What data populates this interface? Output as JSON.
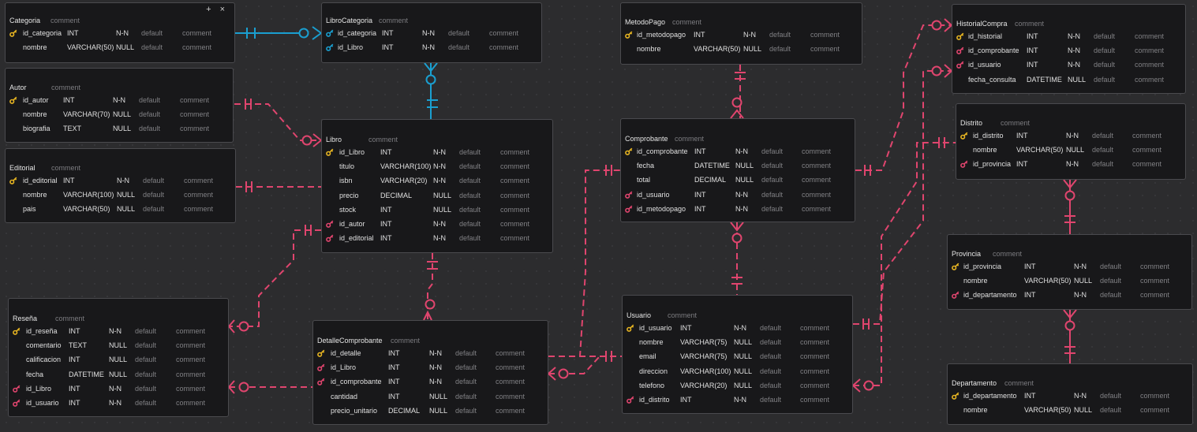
{
  "colors": {
    "pk": "#e6b422",
    "fk_red": "#e0456e",
    "fk_blue": "#1a9fd0",
    "link_red": "#e0456e",
    "link_blue": "#1a9fd0"
  },
  "icons": {
    "pk": "key-icon",
    "fk": "foreign-key-icon",
    "add": "plus-icon",
    "close": "close-icon"
  },
  "tables": [
    {
      "id": "categoria",
      "name": "Categoria",
      "comment": "comment",
      "controls": "+ ×",
      "fields": [
        {
          "name": "id_categoria",
          "type": "INT",
          "null": "N-N",
          "default": "default",
          "comment": "comment",
          "key": "pk"
        },
        {
          "name": "nombre",
          "type": "VARCHAR(50)",
          "null": "NULL",
          "default": "default",
          "comment": "comment",
          "key": ""
        }
      ]
    },
    {
      "id": "librocategoria",
      "name": "LibroCategoria",
      "comment": "comment",
      "fields": [
        {
          "name": "id_categoria",
          "type": "INT",
          "null": "N-N",
          "default": "default",
          "comment": "comment",
          "key": "fk_blue"
        },
        {
          "name": "id_Libro",
          "type": "INT",
          "null": "N-N",
          "default": "default",
          "comment": "comment",
          "key": "fk_blue"
        }
      ]
    },
    {
      "id": "autor",
      "name": "Autor",
      "comment": "comment",
      "fields": [
        {
          "name": "id_autor",
          "type": "INT",
          "null": "N-N",
          "default": "default",
          "comment": "comment",
          "key": "pk"
        },
        {
          "name": "nombre",
          "type": "VARCHAR(70)",
          "null": "NULL",
          "default": "default",
          "comment": "comment",
          "key": ""
        },
        {
          "name": "biografia",
          "type": "TEXT",
          "null": "NULL",
          "default": "default",
          "comment": "comment",
          "key": ""
        }
      ]
    },
    {
      "id": "editorial",
      "name": "Editorial",
      "comment": "comment",
      "fields": [
        {
          "name": "id_editorial",
          "type": "INT",
          "null": "N-N",
          "default": "default",
          "comment": "comment",
          "key": "pk"
        },
        {
          "name": "nombre",
          "type": "VARCHAR(100)",
          "null": "NULL",
          "default": "default",
          "comment": "comment",
          "key": ""
        },
        {
          "name": "pais",
          "type": "VARCHAR(50)",
          "null": "NULL",
          "default": "default",
          "comment": "comment",
          "key": ""
        }
      ]
    },
    {
      "id": "libro",
      "name": "Libro",
      "comment": "comment",
      "fields": [
        {
          "name": "id_Libro",
          "type": "INT",
          "null": "N-N",
          "default": "default",
          "comment": "comment",
          "key": "pk"
        },
        {
          "name": "titulo",
          "type": "VARCHAR(100)",
          "null": "N-N",
          "default": "default",
          "comment": "comment",
          "key": ""
        },
        {
          "name": "isbn",
          "type": "VARCHAR(20)",
          "null": "N-N",
          "default": "default",
          "comment": "comment",
          "key": ""
        },
        {
          "name": "precio",
          "type": "DECIMAL",
          "null": "NULL",
          "default": "default",
          "comment": "comment",
          "key": ""
        },
        {
          "name": "stock",
          "type": "INT",
          "null": "NULL",
          "default": "default",
          "comment": "comment",
          "key": ""
        },
        {
          "name": "id_autor",
          "type": "INT",
          "null": "N-N",
          "default": "default",
          "comment": "comment",
          "key": "fk"
        },
        {
          "name": "id_editorial",
          "type": "INT",
          "null": "N-N",
          "default": "default",
          "comment": "comment",
          "key": "fk"
        }
      ]
    },
    {
      "id": "resena",
      "name": "Reseña",
      "comment": "comment",
      "fields": [
        {
          "name": "id_reseña",
          "type": "INT",
          "null": "N-N",
          "default": "default",
          "comment": "comment",
          "key": "pk"
        },
        {
          "name": "comentario",
          "type": "TEXT",
          "null": "NULL",
          "default": "default",
          "comment": "comment",
          "key": ""
        },
        {
          "name": "calificacion",
          "type": "INT",
          "null": "NULL",
          "default": "default",
          "comment": "comment",
          "key": ""
        },
        {
          "name": "fecha",
          "type": "DATETIME",
          "null": "NULL",
          "default": "default",
          "comment": "comment",
          "key": ""
        },
        {
          "name": "id_Libro",
          "type": "INT",
          "null": "N-N",
          "default": "default",
          "comment": "comment",
          "key": "fk"
        },
        {
          "name": "id_usuario",
          "type": "INT",
          "null": "N-N",
          "default": "default",
          "comment": "comment",
          "key": "fk"
        }
      ]
    },
    {
      "id": "detallecomprobante",
      "name": "DetalleComprobante",
      "comment": "comment",
      "fields": [
        {
          "name": "id_detalle",
          "type": "INT",
          "null": "N-N",
          "default": "default",
          "comment": "comment",
          "key": "pk"
        },
        {
          "name": "id_Libro",
          "type": "INT",
          "null": "N-N",
          "default": "default",
          "comment": "comment",
          "key": "fk"
        },
        {
          "name": "id_comprobante",
          "type": "INT",
          "null": "N-N",
          "default": "default",
          "comment": "comment",
          "key": "fk"
        },
        {
          "name": "cantidad",
          "type": "INT",
          "null": "NULL",
          "default": "default",
          "comment": "comment",
          "key": ""
        },
        {
          "name": "precio_unitario",
          "type": "DECIMAL",
          "null": "NULL",
          "default": "default",
          "comment": "comment",
          "key": ""
        }
      ]
    },
    {
      "id": "metodopago",
      "name": "MetodoPago",
      "comment": "comment",
      "fields": [
        {
          "name": "id_metodopago",
          "type": "INT",
          "null": "N-N",
          "default": "default",
          "comment": "comment",
          "key": "pk"
        },
        {
          "name": "nombre",
          "type": "VARCHAR(50)",
          "null": "NULL",
          "default": "default",
          "comment": "comment",
          "key": ""
        }
      ]
    },
    {
      "id": "comprobante",
      "name": "Comprobante",
      "comment": "comment",
      "fields": [
        {
          "name": "id_comprobante",
          "type": "INT",
          "null": "N-N",
          "default": "default",
          "comment": "comment",
          "key": "pk"
        },
        {
          "name": "fecha",
          "type": "DATETIME",
          "null": "NULL",
          "default": "default",
          "comment": "comment",
          "key": ""
        },
        {
          "name": "total",
          "type": "DECIMAL",
          "null": "NULL",
          "default": "default",
          "comment": "comment",
          "key": ""
        },
        {
          "name": "id_usuario",
          "type": "INT",
          "null": "N-N",
          "default": "default",
          "comment": "comment",
          "key": "fk"
        },
        {
          "name": "id_metodopago",
          "type": "INT",
          "null": "N-N",
          "default": "default",
          "comment": "comment",
          "key": "fk"
        }
      ]
    },
    {
      "id": "usuario",
      "name": "Usuario",
      "comment": "comment",
      "fields": [
        {
          "name": "id_usuario",
          "type": "INT",
          "null": "N-N",
          "default": "default",
          "comment": "comment",
          "key": "pk"
        },
        {
          "name": "nombre",
          "type": "VARCHAR(75)",
          "null": "NULL",
          "default": "default",
          "comment": "comment",
          "key": ""
        },
        {
          "name": "email",
          "type": "VARCHAR(75)",
          "null": "NULL",
          "default": "default",
          "comment": "comment",
          "key": ""
        },
        {
          "name": "direccion",
          "type": "VARCHAR(100)",
          "null": "NULL",
          "default": "default",
          "comment": "comment",
          "key": ""
        },
        {
          "name": "telefono",
          "type": "VARCHAR(20)",
          "null": "NULL",
          "default": "default",
          "comment": "comment",
          "key": ""
        },
        {
          "name": "id_distrito",
          "type": "INT",
          "null": "N-N",
          "default": "default",
          "comment": "comment",
          "key": "fk"
        }
      ]
    },
    {
      "id": "historialcompra",
      "name": "HistorialCompra",
      "comment": "comment",
      "fields": [
        {
          "name": "id_historial",
          "type": "INT",
          "null": "N-N",
          "default": "default",
          "comment": "comment",
          "key": "pk"
        },
        {
          "name": "id_comprobante",
          "type": "INT",
          "null": "N-N",
          "default": "default",
          "comment": "comment",
          "key": "fk"
        },
        {
          "name": "id_usuario",
          "type": "INT",
          "null": "N-N",
          "default": "default",
          "comment": "comment",
          "key": "fk"
        },
        {
          "name": "fecha_consulta",
          "type": "DATETIME",
          "null": "NULL",
          "default": "default",
          "comment": "comment",
          "key": ""
        }
      ]
    },
    {
      "id": "distrito",
      "name": "Distrito",
      "comment": "comment",
      "fields": [
        {
          "name": "id_distrito",
          "type": "INT",
          "null": "N-N",
          "default": "default",
          "comment": "comment",
          "key": "pk"
        },
        {
          "name": "nombre",
          "type": "VARCHAR(50)",
          "null": "NULL",
          "default": "default",
          "comment": "comment",
          "key": ""
        },
        {
          "name": "id_provincia",
          "type": "INT",
          "null": "N-N",
          "default": "default",
          "comment": "comment",
          "key": "fk"
        }
      ]
    },
    {
      "id": "provincia",
      "name": "Provincia",
      "comment": "comment",
      "fields": [
        {
          "name": "id_provincia",
          "type": "INT",
          "null": "N-N",
          "default": "default",
          "comment": "comment",
          "key": "pk"
        },
        {
          "name": "nombre",
          "type": "VARCHAR(50)",
          "null": "NULL",
          "default": "default",
          "comment": "comment",
          "key": ""
        },
        {
          "name": "id_departamento",
          "type": "INT",
          "null": "N-N",
          "default": "default",
          "comment": "comment",
          "key": "fk"
        }
      ]
    },
    {
      "id": "departamento",
      "name": "Departamento",
      "comment": "comment",
      "fields": [
        {
          "name": "id_departamento",
          "type": "INT",
          "null": "N-N",
          "default": "default",
          "comment": "comment",
          "key": "pk"
        },
        {
          "name": "nombre",
          "type": "VARCHAR(50)",
          "null": "NULL",
          "default": "default",
          "comment": "comment",
          "key": ""
        }
      ]
    }
  ]
}
